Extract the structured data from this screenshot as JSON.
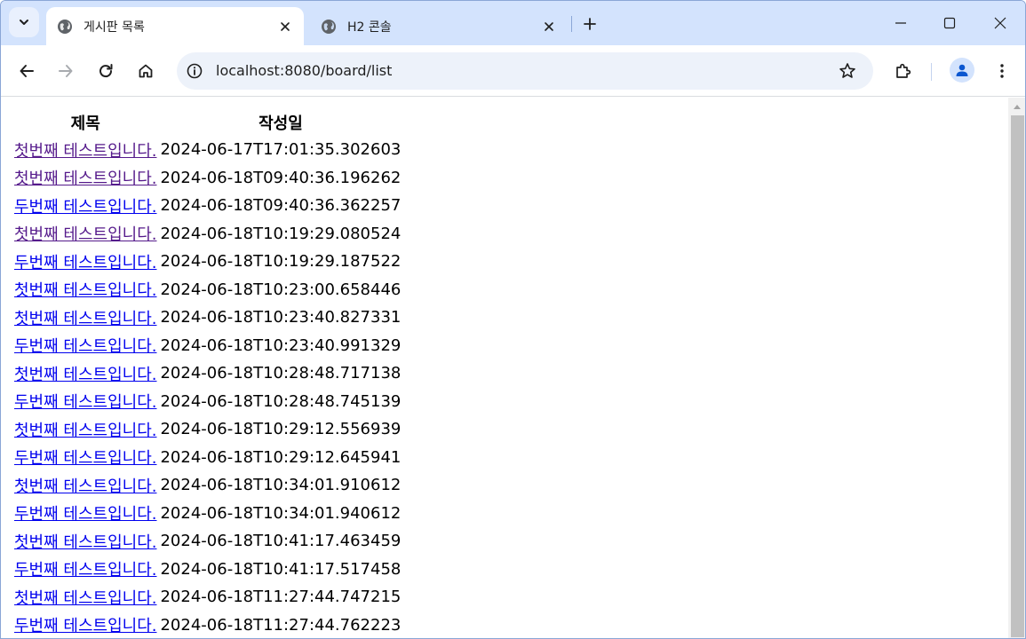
{
  "browser": {
    "tabs": [
      {
        "title": "게시판 목록",
        "active": true
      },
      {
        "title": "H2 콘솔",
        "active": false
      }
    ],
    "url": "localhost:8080/board/list",
    "icons": {
      "tab_search": "chevron-down-icon",
      "tab_favicon": "globe-icon",
      "tab_close": "close-icon",
      "new_tab": "plus-icon",
      "minimize": "minimize-icon",
      "maximize": "maximize-icon",
      "close_window": "close-icon",
      "back": "back-arrow-icon",
      "forward": "forward-arrow-icon",
      "reload": "reload-icon",
      "home": "home-icon",
      "site_info": "info-icon",
      "bookmark": "star-icon",
      "extensions": "puzzle-icon",
      "profile": "person-icon",
      "menu": "kebab-menu-icon"
    }
  },
  "board": {
    "headers": {
      "title": "제목",
      "created": "작성일"
    },
    "rows": [
      {
        "title": "첫번째 테스트입니다.",
        "created": "2024-06-17T17:01:35.302603",
        "visited": true
      },
      {
        "title": "첫번째 테스트입니다.",
        "created": "2024-06-18T09:40:36.196262",
        "visited": true
      },
      {
        "title": "두번째 테스트입니다.",
        "created": "2024-06-18T09:40:36.362257",
        "visited": false
      },
      {
        "title": "첫번째 테스트입니다.",
        "created": "2024-06-18T10:19:29.080524",
        "visited": true
      },
      {
        "title": "두번째 테스트입니다.",
        "created": "2024-06-18T10:19:29.187522",
        "visited": false
      },
      {
        "title": "첫번째 테스트입니다.",
        "created": "2024-06-18T10:23:00.658446",
        "visited": false
      },
      {
        "title": "첫번째 테스트입니다.",
        "created": "2024-06-18T10:23:40.827331",
        "visited": false
      },
      {
        "title": "두번째 테스트입니다.",
        "created": "2024-06-18T10:23:40.991329",
        "visited": false
      },
      {
        "title": "첫번째 테스트입니다.",
        "created": "2024-06-18T10:28:48.717138",
        "visited": false
      },
      {
        "title": "두번째 테스트입니다.",
        "created": "2024-06-18T10:28:48.745139",
        "visited": false
      },
      {
        "title": "첫번째 테스트입니다.",
        "created": "2024-06-18T10:29:12.556939",
        "visited": false
      },
      {
        "title": "두번째 테스트입니다.",
        "created": "2024-06-18T10:29:12.645941",
        "visited": false
      },
      {
        "title": "첫번째 테스트입니다.",
        "created": "2024-06-18T10:34:01.910612",
        "visited": false
      },
      {
        "title": "두번째 테스트입니다.",
        "created": "2024-06-18T10:34:01.940612",
        "visited": false
      },
      {
        "title": "첫번째 테스트입니다.",
        "created": "2024-06-18T10:41:17.463459",
        "visited": false
      },
      {
        "title": "두번째 테스트입니다.",
        "created": "2024-06-18T10:41:17.517458",
        "visited": false
      },
      {
        "title": "첫번째 테스트입니다.",
        "created": "2024-06-18T11:27:44.747215",
        "visited": false
      },
      {
        "title": "두번째 테스트입니다.",
        "created": "2024-06-18T11:27:44.762223",
        "visited": false
      }
    ]
  },
  "colors": {
    "tabstrip": "#d3e3fd",
    "omnibox": "#edf2fa",
    "link": "#0000ee",
    "visited_link": "#551a8b"
  }
}
